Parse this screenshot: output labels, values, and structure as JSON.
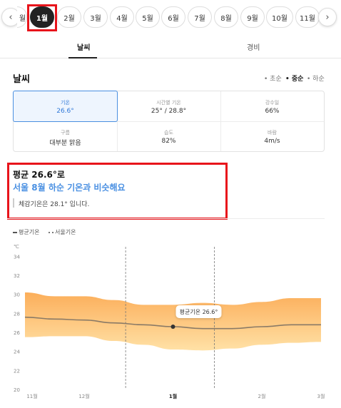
{
  "months": {
    "prev_icon": "chevron-left-icon",
    "next_icon": "chevron-right-icon",
    "partial_label": "월",
    "items": [
      "1월",
      "2월",
      "3월",
      "4월",
      "5월",
      "6월",
      "7월",
      "8월",
      "9월",
      "10월",
      "11월"
    ],
    "selected": "1월"
  },
  "tabs": {
    "weather": "날씨",
    "cost": "경비"
  },
  "weather": {
    "title": "날씨",
    "seasons": {
      "early": "초순",
      "mid": "중순",
      "late": "하순"
    },
    "stats": {
      "temp": {
        "label": "기온",
        "value": "26.6°"
      },
      "hourly": {
        "label": "시간별 기온",
        "value": "25° / 28.8°"
      },
      "precip": {
        "label": "강수일",
        "value": "66%"
      },
      "cloud": {
        "label": "구름",
        "value": "대부분 맑음"
      },
      "humidity": {
        "label": "습도",
        "value": "82%"
      },
      "wind": {
        "label": "바람",
        "value": "4m/s"
      }
    }
  },
  "summary": {
    "line1": "평균 26.6°로",
    "line2": "서울 8월 하순 기온과 비슷해요",
    "line3": "체감기온은 28.1° 입니다."
  },
  "legend": {
    "avg": "평균기온",
    "seoul": "서울기온"
  },
  "colors": {
    "accent_blue": "#4a90e2",
    "highlight_red": "#e8141b",
    "band_top": "#fcae5a",
    "band_bottom": "#ffe1a6"
  },
  "chart_data": {
    "type": "area",
    "ylabel": "℃",
    "yticks": [
      20,
      22,
      24,
      26,
      28,
      30,
      32,
      34
    ],
    "ylim": [
      20,
      35
    ],
    "xticks": [
      {
        "label": "11월",
        "x": 0
      },
      {
        "label": "12월",
        "x": 1
      },
      {
        "label": "1월",
        "x": 2.5,
        "bold": true
      },
      {
        "label": "2월",
        "x": 4
      },
      {
        "label": "3월",
        "x": 5
      }
    ],
    "xlim": [
      0,
      5
    ],
    "vlines": [
      1.7,
      3.2
    ],
    "band": {
      "x": [
        0,
        0.5,
        1,
        1.5,
        2,
        2.5,
        3,
        3.5,
        4,
        4.5,
        5
      ],
      "high": [
        30.2,
        29.8,
        29.8,
        29.4,
        28.9,
        28.9,
        29.1,
        28.9,
        29.2,
        29.6,
        29.6
      ],
      "low": [
        25.5,
        25.6,
        25.6,
        25.1,
        24.7,
        24.2,
        24.1,
        24.3,
        24.7,
        24.9,
        25.0
      ]
    },
    "series": [
      {
        "name": "평균기온",
        "x": [
          0,
          0.5,
          1,
          1.5,
          2,
          2.5,
          3,
          3.5,
          4,
          4.5,
          5
        ],
        "values": [
          27.6,
          27.4,
          27.3,
          27.0,
          26.8,
          26.6,
          26.4,
          26.4,
          26.6,
          26.8,
          26.8
        ]
      }
    ],
    "tooltip": {
      "text": "평균기온 26.6°",
      "x": 2.5,
      "y": 26.6
    }
  }
}
